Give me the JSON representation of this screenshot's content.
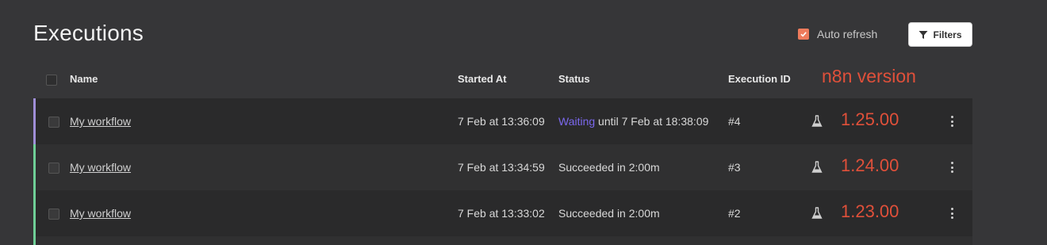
{
  "page": {
    "title": "Executions"
  },
  "toolbar": {
    "auto_refresh_label": "Auto refresh",
    "auto_refresh_checked": true,
    "filters_label": "Filters"
  },
  "table": {
    "headers": {
      "name": "Name",
      "started_at": "Started At",
      "status": "Status",
      "execution_id": "Execution ID"
    },
    "rows": [
      {
        "name": "My workflow",
        "started_at": "7 Feb at 13:36:09",
        "status_highlight": "Waiting",
        "status_text": " until 7 Feb at 18:38:09",
        "execution_id": "#4",
        "version": "1.25.00",
        "state": "waiting"
      },
      {
        "name": "My workflow",
        "started_at": "7 Feb at 13:34:59",
        "status_highlight": "",
        "status_text": "Succeeded in 2:00m",
        "execution_id": "#3",
        "version": "1.24.00",
        "state": "success"
      },
      {
        "name": "My workflow",
        "started_at": "7 Feb at 13:33:02",
        "status_highlight": "",
        "status_text": "Succeeded in 2:00m",
        "execution_id": "#2",
        "version": "1.23.00",
        "state": "success"
      }
    ]
  },
  "annotation": {
    "version_header": "n8n version"
  },
  "colors": {
    "accent": "#ee7b5c",
    "waiting": "#7b68ee",
    "success_bar": "#6fcf97",
    "waiting_bar": "#a08fd8",
    "annotation": "#e0503a"
  }
}
